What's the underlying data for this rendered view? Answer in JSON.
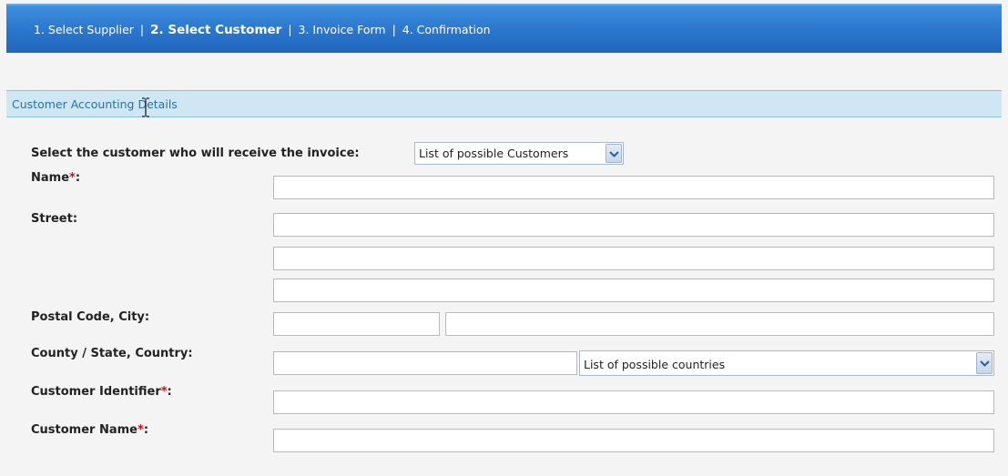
{
  "wizard": {
    "steps": [
      {
        "label": "1. Select Supplier",
        "active": false
      },
      {
        "label": "2. Select Customer",
        "active": true
      },
      {
        "label": "3. Invoice Form",
        "active": false
      },
      {
        "label": "4. Confirmation",
        "active": false
      }
    ],
    "separator": "|"
  },
  "section": {
    "title": "Customer Accounting Details"
  },
  "form": {
    "select_customer_label": "Select the customer who will receive the invoice:",
    "customer_select_value": "List of possible Customers",
    "name_label": "Name",
    "street_label": "Street:",
    "postal_city_label": "Postal Code, City:",
    "county_country_label": "County / State, Country:",
    "country_select_value": "List of possible countries",
    "customer_identifier_label": "Customer Identifier",
    "customer_name_label": "Customer Name",
    "required_marker": "*",
    "colon": ":"
  },
  "colors": {
    "wizard_bar": "#2b78cf",
    "section_header": "#cfe7f2",
    "required": "#cc1111"
  }
}
